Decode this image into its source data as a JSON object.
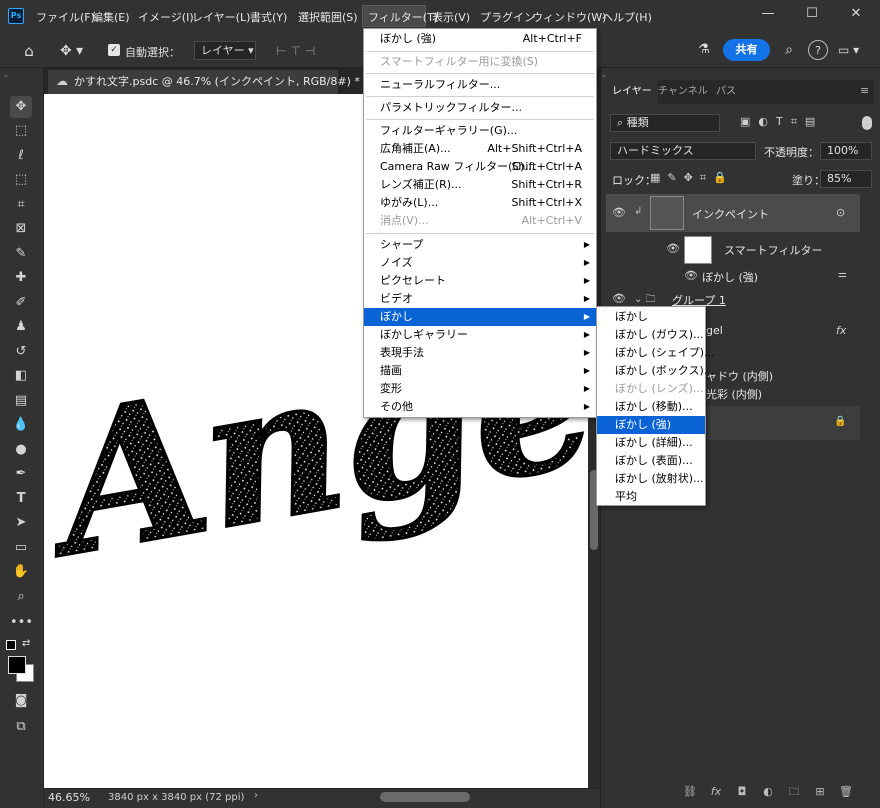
{
  "menubar": {
    "items": [
      "ファイル(F)",
      "編集(E)",
      "イメージ(I)",
      "レイヤー(L)",
      "書式(Y)",
      "選択範囲(S)",
      "フィルター(T)",
      "表示(V)",
      "プラグイン",
      "ウィンドウ(W)",
      "ヘルプ(H)"
    ]
  },
  "options": {
    "auto_select_label": "自動選択：",
    "auto_select_target": "レイヤー",
    "share_label": "共有"
  },
  "document": {
    "tab_title": "かすれ文字.psdc @ 46.7% (インクペイント, RGB/8#) *",
    "canvas_text": "Angel",
    "zoom": "46.65%",
    "size": "3840 px x 3840 px (72 ppi)"
  },
  "panels": {
    "tabs": [
      "レイヤー",
      "チャンネル",
      "パス"
    ],
    "filter_kind": "種類",
    "blend_mode": "ハードミックス",
    "opacity_label": "不透明度：",
    "opacity_value": "100%",
    "lock_label": "ロック：",
    "fill_label": "塗り：",
    "fill_value": "85%",
    "layers": {
      "ink_paint": "インクペイント",
      "smart_filter": "スマートフィルター",
      "blur_strong": "ぼかし (強)",
      "group1": "グループ 1",
      "angel_partial": "gel",
      "inner_shadow_partial": "ャドウ (内側)",
      "inner_glow_partial": "光彩 (内側)"
    }
  },
  "filter_menu": {
    "items": [
      {
        "label": "ぼかし (強)",
        "shortcut": "Alt+Ctrl+F",
        "disabled": false
      },
      {
        "label": "スマートフィルター用に変換(S)",
        "shortcut": "",
        "disabled": true
      },
      {
        "label": "ニューラルフィルター...",
        "shortcut": "",
        "disabled": false
      },
      {
        "label": "パラメトリックフィルター...",
        "shortcut": "",
        "disabled": false
      },
      {
        "label": "フィルターギャラリー(G)...",
        "shortcut": "",
        "disabled": false
      },
      {
        "label": "広角補正(A)...",
        "shortcut": "Alt+Shift+Ctrl+A",
        "disabled": false
      },
      {
        "label": "Camera Raw フィルター(C)...",
        "shortcut": "Shift+Ctrl+A",
        "disabled": false
      },
      {
        "label": "レンズ補正(R)...",
        "shortcut": "Shift+Ctrl+R",
        "disabled": false
      },
      {
        "label": "ゆがみ(L)...",
        "shortcut": "Shift+Ctrl+X",
        "disabled": false
      },
      {
        "label": "消点(V)...",
        "shortcut": "Alt+Ctrl+V",
        "disabled": true
      },
      {
        "label": "シャープ",
        "shortcut": "",
        "disabled": false
      },
      {
        "label": "ノイズ",
        "shortcut": "",
        "disabled": false
      },
      {
        "label": "ピクセレート",
        "shortcut": "",
        "disabled": false
      },
      {
        "label": "ビデオ",
        "shortcut": "",
        "disabled": false
      },
      {
        "label": "ぼかし",
        "shortcut": "",
        "disabled": false
      },
      {
        "label": "ぼかしギャラリー",
        "shortcut": "",
        "disabled": false
      },
      {
        "label": "表現手法",
        "shortcut": "",
        "disabled": false
      },
      {
        "label": "描画",
        "shortcut": "",
        "disabled": false
      },
      {
        "label": "変形",
        "shortcut": "",
        "disabled": false
      },
      {
        "label": "その他",
        "shortcut": "",
        "disabled": false
      }
    ]
  },
  "blur_submenu": {
    "items": [
      {
        "label": "ぼかし",
        "disabled": false
      },
      {
        "label": "ぼかし (ガウス)...",
        "disabled": false
      },
      {
        "label": "ぼかし (シェイプ)...",
        "disabled": false
      },
      {
        "label": "ぼかし (ボックス)...",
        "disabled": false
      },
      {
        "label": "ぼかし (レンズ)...",
        "disabled": true
      },
      {
        "label": "ぼかし (移動)...",
        "disabled": false
      },
      {
        "label": "ぼかし (強)",
        "disabled": false
      },
      {
        "label": "ぼかし (詳細)...",
        "disabled": false
      },
      {
        "label": "ぼかし (表面)...",
        "disabled": false
      },
      {
        "label": "ぼかし (放射状)...",
        "disabled": false
      },
      {
        "label": "平均",
        "disabled": false
      }
    ]
  },
  "colors": {
    "accent": "#0a64d6",
    "share": "#1473e6",
    "ps_logo": "#31a8ff"
  },
  "icons": {
    "home": "home-icon",
    "move": "move-icon",
    "search": "search-icon",
    "help": "help-icon",
    "eye": "eye-icon"
  }
}
